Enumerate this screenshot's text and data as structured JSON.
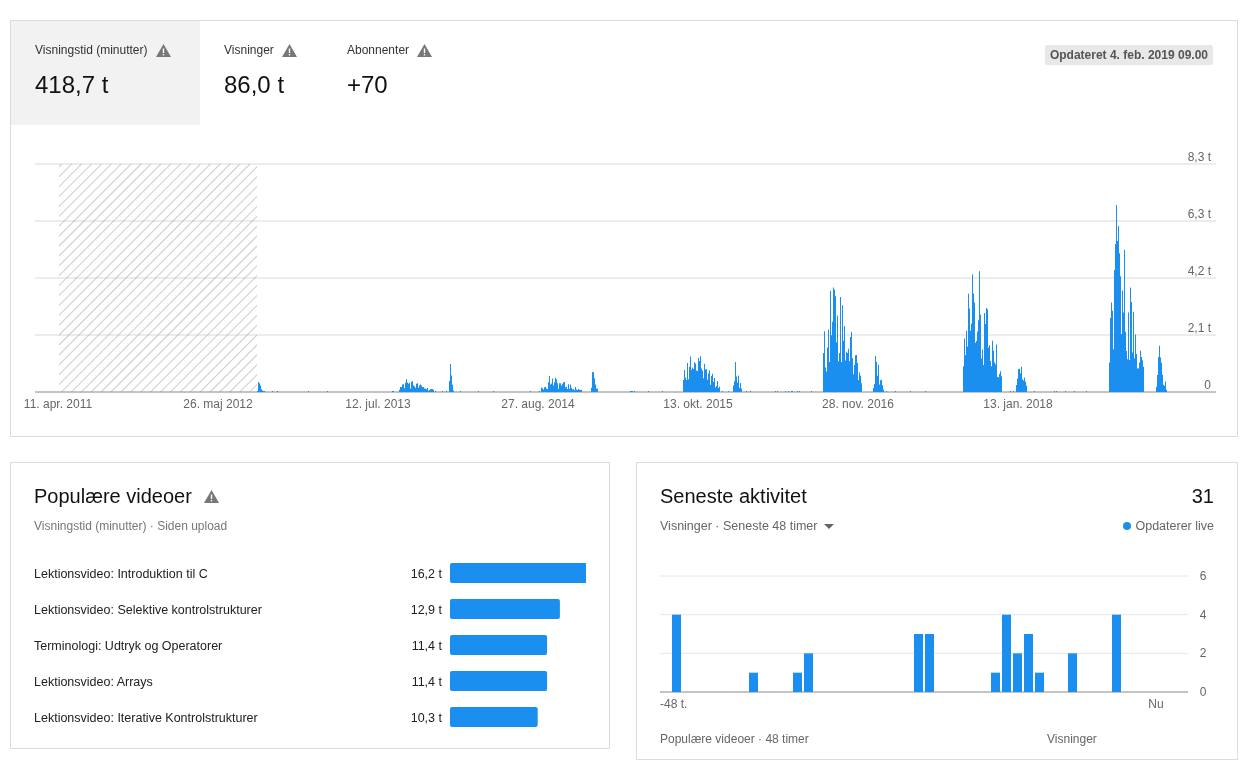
{
  "metrics": [
    {
      "label": "Visningstid (minutter)",
      "value": "418,7 t",
      "selected": true
    },
    {
      "label": "Visninger",
      "value": "86,0 t",
      "selected": false
    },
    {
      "label": "Abonnenter",
      "value": "+70",
      "selected": false
    }
  ],
  "updated": "Opdateret 4. feb. 2019 09.00",
  "timeline": {
    "y_labels": [
      "8,3 t",
      "6,3 t",
      "4,2 t",
      "2,1 t",
      "0"
    ],
    "x_labels": [
      "11. apr. 2011",
      "26. maj 2012",
      "12. jul. 2013",
      "27. aug. 2014",
      "13. okt. 2015",
      "28. nov. 2016",
      "13. jan. 2018"
    ]
  },
  "popular": {
    "title": "Populære videoer",
    "subtitle": "Visningstid (minutter) · Siden upload",
    "chart_data": {
      "type": "bar",
      "orientation": "horizontal",
      "color": "#1a8ff0",
      "categories": [
        "Lektionsvideo: Introduktion til C",
        "Lektionsvideo: Selektive kontrolstrukturer",
        "Terminologi: Udtryk og Operatorer",
        "Lektionsvideo: Arrays",
        "Lektionsvideo: Iterative Kontrolstrukturer"
      ],
      "values": [
        16.2,
        12.9,
        11.4,
        11.4,
        10.3
      ],
      "value_labels": [
        "16,2 t",
        "12,9 t",
        "11,4 t",
        "11,4 t",
        "10,3 t"
      ]
    }
  },
  "activity": {
    "title": "Seneste aktivitet",
    "total": "31",
    "selector": "Visninger · Seneste 48 timer",
    "live": "Opdaterer live",
    "chart_data": {
      "type": "bar",
      "color": "#1a8ff0",
      "values": [
        0,
        4,
        0,
        0,
        0,
        0,
        0,
        0,
        1,
        0,
        0,
        0,
        1,
        2,
        0,
        0,
        0,
        0,
        0,
        0,
        0,
        0,
        0,
        3,
        3,
        0,
        0,
        0,
        0,
        0,
        1,
        4,
        2,
        3,
        1,
        0,
        0,
        2,
        0,
        0,
        0,
        4,
        0,
        0,
        0,
        0,
        0,
        0
      ],
      "ylim": [
        0,
        6
      ],
      "yticks": [
        0,
        2,
        4,
        6
      ]
    },
    "x_axis_labels": [
      "-48 t.",
      "Nu"
    ],
    "footer": [
      "Populære videoer · 48 timer",
      "Visninger"
    ]
  }
}
